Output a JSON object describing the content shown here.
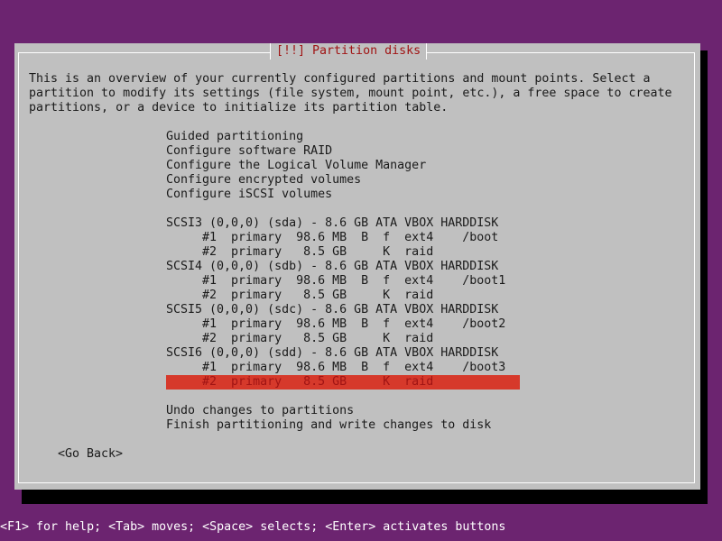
{
  "dialog": {
    "title": "[!!] Partition disks",
    "description": [
      "This is an overview of your currently configured partitions and mount points. Select a",
      "partition to modify its settings (file system, mount point, etc.), a free space to create",
      "partitions, or a device to initialize its partition table."
    ],
    "menu": {
      "actions": [
        "Guided partitioning",
        "Configure software RAID",
        "Configure the Logical Volume Manager",
        "Configure encrypted volumes",
        "Configure iSCSI volumes"
      ],
      "disks": [
        {
          "label": "SCSI3 (0,0,0) (sda) - 8.6 GB ATA VBOX HARDDISK",
          "partitions": [
            "     #1  primary  98.6 MB  B  f  ext4    /boot",
            "     #2  primary   8.5 GB     K  raid"
          ]
        },
        {
          "label": "SCSI4 (0,0,0) (sdb) - 8.6 GB ATA VBOX HARDDISK",
          "partitions": [
            "     #1  primary  98.6 MB  B  f  ext4    /boot1",
            "     #2  primary   8.5 GB     K  raid"
          ]
        },
        {
          "label": "SCSI5 (0,0,0) (sdc) - 8.6 GB ATA VBOX HARDDISK",
          "partitions": [
            "     #1  primary  98.6 MB  B  f  ext4    /boot2",
            "     #2  primary   8.5 GB     K  raid"
          ]
        },
        {
          "label": "SCSI6 (0,0,0) (sdd) - 8.6 GB ATA VBOX HARDDISK",
          "partitions": [
            "     #1  primary  98.6 MB  B  f  ext4    /boot3",
            "     #2  primary   8.5 GB     K  raid"
          ]
        }
      ],
      "finish": [
        "Undo changes to partitions",
        "Finish partitioning and write changes to disk"
      ]
    },
    "go_back_label": "<Go Back>"
  },
  "status_bar": "<F1> for help; <Tab> moves; <Space> selects; <Enter> activates buttons",
  "colors": {
    "background": "#6c2470",
    "dialog": "#c0c0c0",
    "title_text": "#a01414",
    "selection_highlight": "#d6392b"
  }
}
